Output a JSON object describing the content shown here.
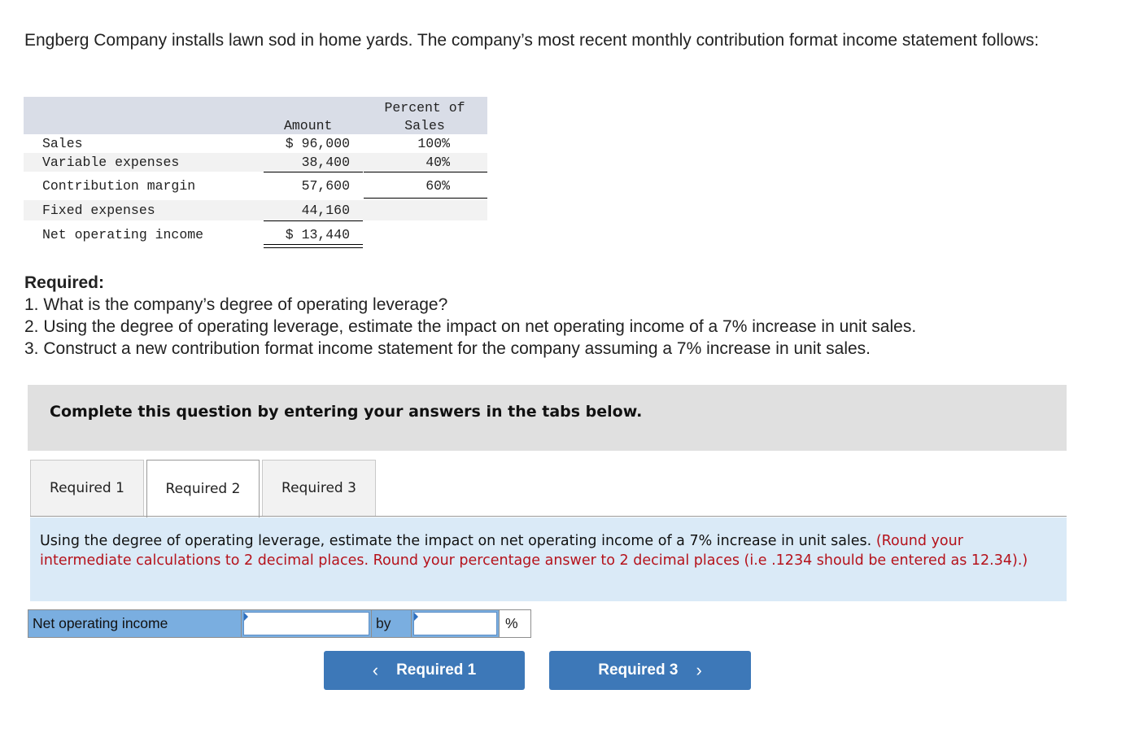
{
  "intro": "Engberg Company installs lawn sod in home yards. The company’s most recent monthly contribution format income statement follows:",
  "statement": {
    "headers": {
      "amount": "Amount",
      "percent_line1": "Percent of",
      "percent_line2": "Sales"
    },
    "rows": [
      {
        "label": "Sales",
        "amount": "$ 96,000",
        "percent": "100%"
      },
      {
        "label": "Variable expenses",
        "amount": "38,400",
        "percent": "40%"
      },
      {
        "label": "Contribution margin",
        "amount": "57,600",
        "percent": "60%"
      },
      {
        "label": "Fixed expenses",
        "amount": "44,160",
        "percent": ""
      },
      {
        "label": "Net operating income",
        "amount": "$ 13,440",
        "percent": ""
      }
    ]
  },
  "required": {
    "title": "Required:",
    "items": [
      "1. What is the company’s degree of operating leverage?",
      "2. Using the degree of operating leverage, estimate the impact on net operating income of a 7% increase in unit sales.",
      "3. Construct a new contribution format income statement for the company assuming a 7% increase in unit sales."
    ]
  },
  "banner": "Complete this question by entering your answers in the tabs below.",
  "tabs": [
    {
      "label": "Required 1",
      "active": false
    },
    {
      "label": "Required 2",
      "active": true
    },
    {
      "label": "Required 3",
      "active": false
    }
  ],
  "panel": {
    "question": "Using the degree of operating leverage, estimate the impact on net operating income of a 7% increase in unit sales. ",
    "instruction": "(Round your intermediate calculations to 2 decimal places. Round your percentage answer to 2 decimal places (i.e .1234 should be entered as 12.34).)"
  },
  "answer_row": {
    "label": "Net operating income",
    "input1_value": "",
    "by_label": "by",
    "input2_value": "",
    "unit": "%"
  },
  "nav": {
    "prev_label": "Required 1",
    "next_label": "Required 3",
    "prev_icon": "chevron-left-icon",
    "next_icon": "chevron-right-icon"
  },
  "colors": {
    "button_blue": "#3d78b8",
    "instruction_red": "#b5121b",
    "panel_bg": "#daeaf7",
    "answer_label_bg": "#7aaee0"
  }
}
